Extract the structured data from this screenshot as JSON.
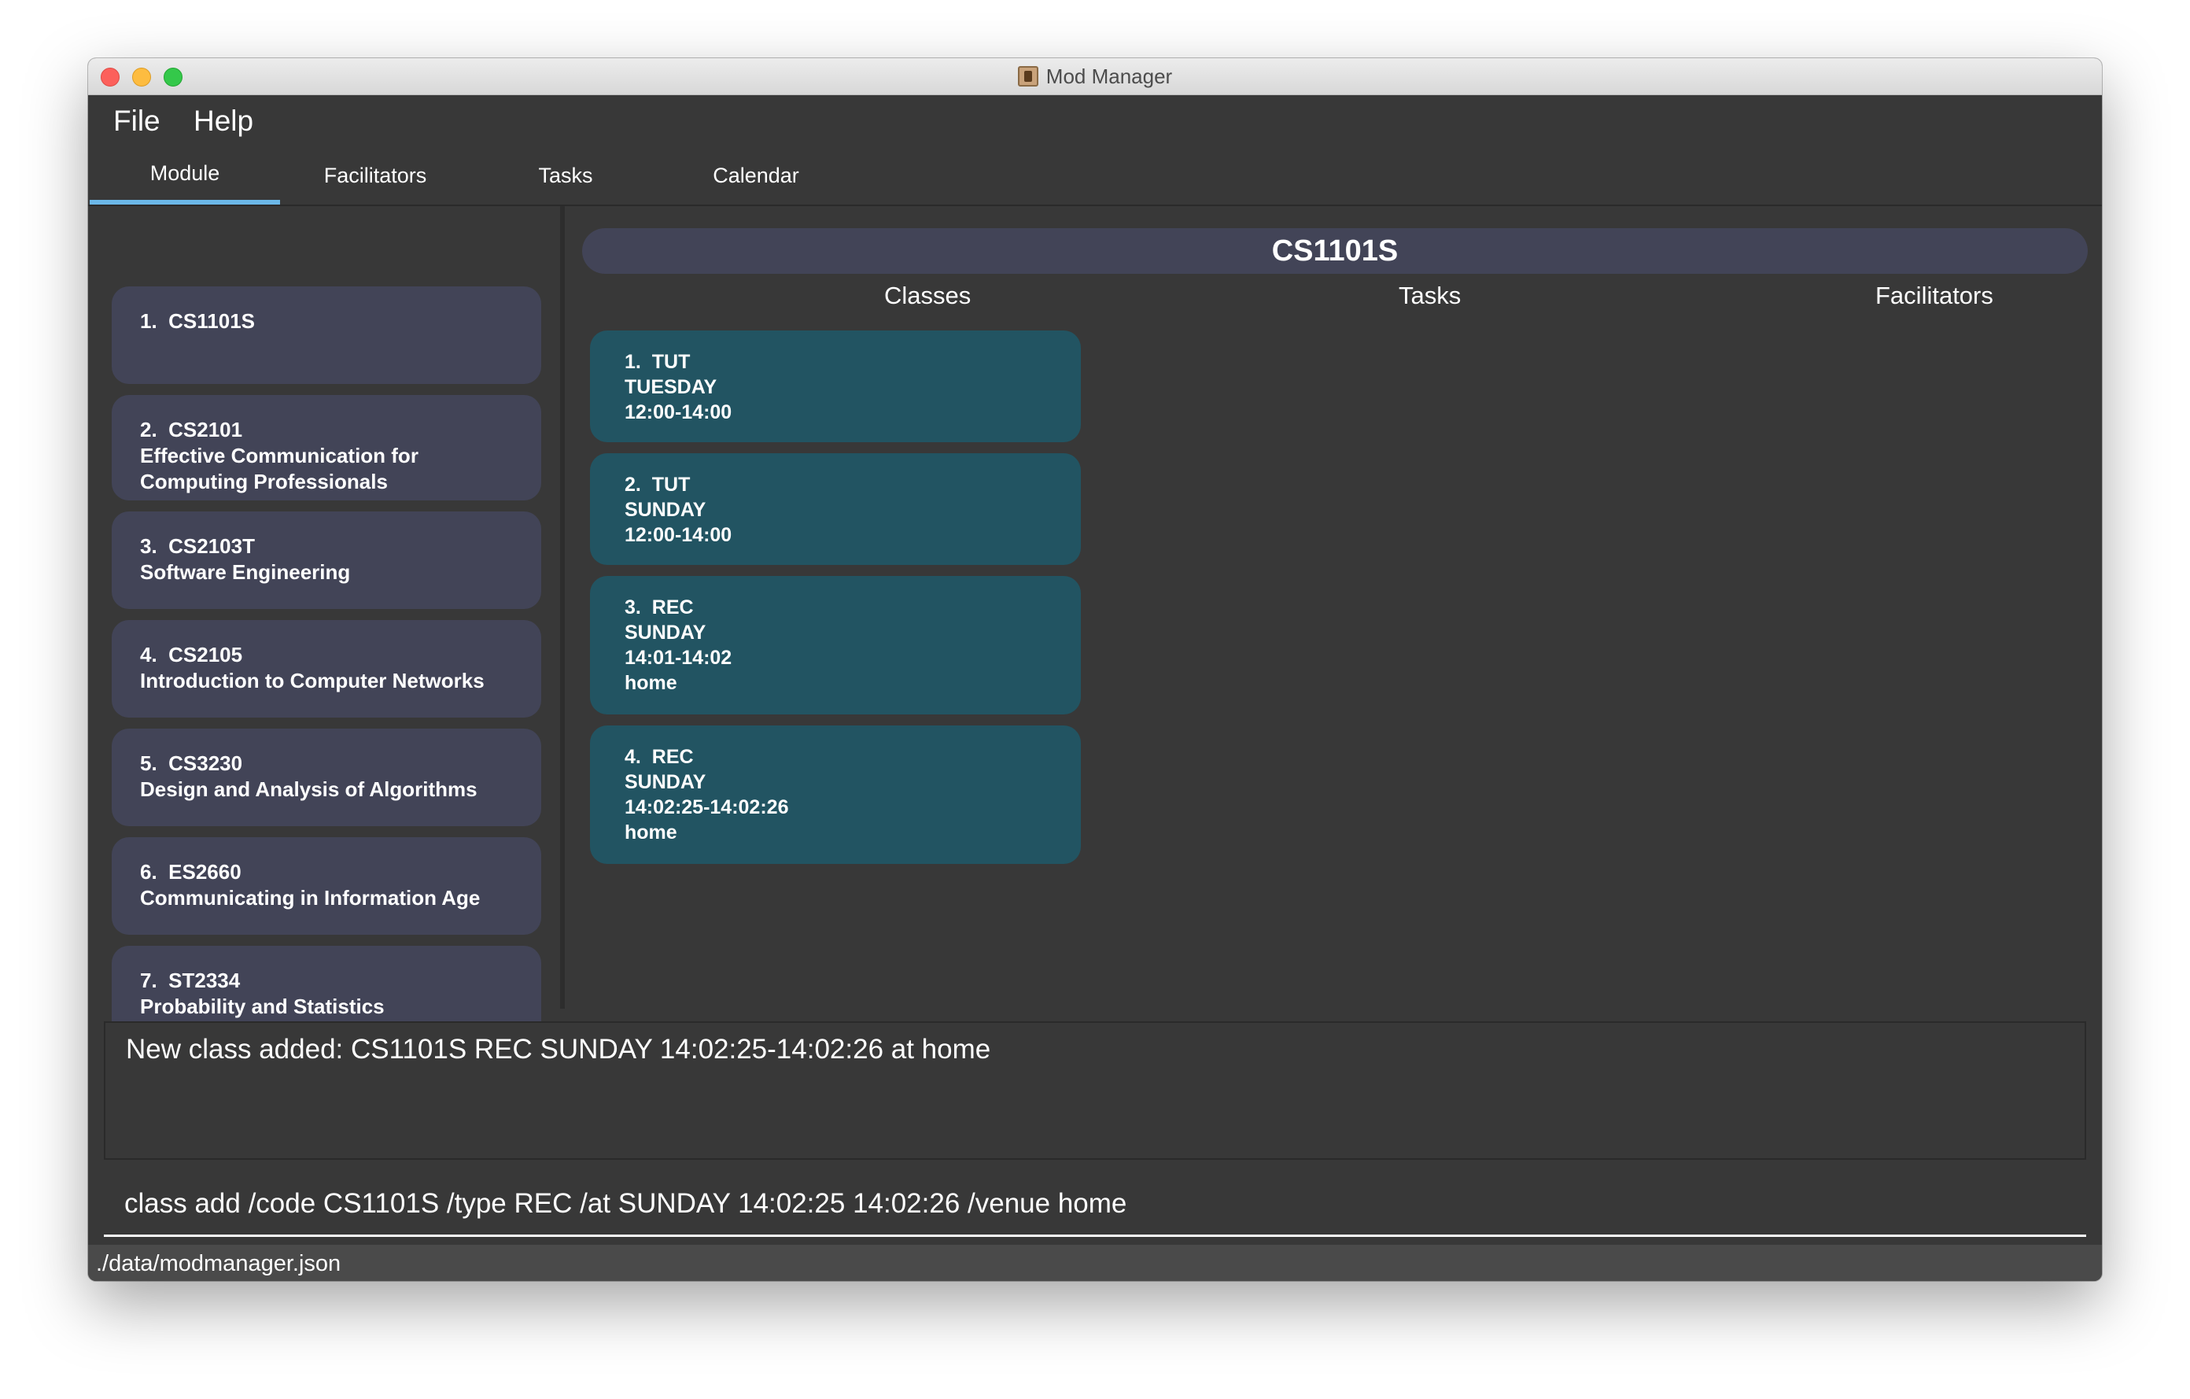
{
  "window": {
    "title": "Mod Manager"
  },
  "menu": {
    "file": "File",
    "help": "Help"
  },
  "tabs": [
    {
      "label": "Module"
    },
    {
      "label": "Facilitators"
    },
    {
      "label": "Tasks"
    },
    {
      "label": "Calendar"
    }
  ],
  "modules": [
    {
      "index": "1.",
      "code": "CS1101S",
      "name": ""
    },
    {
      "index": "2.",
      "code": "CS2101",
      "name": "Effective Communication for Computing Professionals"
    },
    {
      "index": "3.",
      "code": "CS2103T",
      "name": "Software Engineering"
    },
    {
      "index": "4.",
      "code": "CS2105",
      "name": "Introduction to Computer Networks"
    },
    {
      "index": "5.",
      "code": "CS3230",
      "name": "Design and Analysis of Algorithms"
    },
    {
      "index": "6.",
      "code": "ES2660",
      "name": "Communicating in Information Age"
    },
    {
      "index": "7.",
      "code": "ST2334",
      "name": "Probability and Statistics"
    }
  ],
  "detail": {
    "code": "CS1101S",
    "columns": {
      "classes": "Classes",
      "tasks": "Tasks",
      "facilitators": "Facilitators"
    },
    "classes": [
      {
        "index": "1.",
        "type": "TUT",
        "day": "TUESDAY",
        "time": "12:00-14:00",
        "venue": ""
      },
      {
        "index": "2.",
        "type": "TUT",
        "day": "SUNDAY",
        "time": "12:00-14:00",
        "venue": ""
      },
      {
        "index": "3.",
        "type": "REC",
        "day": "SUNDAY",
        "time": "14:01-14:02",
        "venue": "home"
      },
      {
        "index": "4.",
        "type": "REC",
        "day": "SUNDAY",
        "time": "14:02:25-14:02:26",
        "venue": "home"
      }
    ]
  },
  "result": {
    "message": "New class added: CS1101S REC SUNDAY 14:02:25-14:02:26 at home"
  },
  "command": {
    "value": "class add /code CS1101S /type REC /at SUNDAY 14:02:25 14:02:26 /venue home"
  },
  "status": {
    "path": "./data/modmanager.json"
  }
}
